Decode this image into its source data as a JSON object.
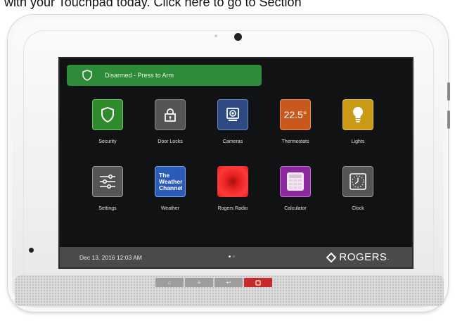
{
  "caption": "with your Touchpad today. Click here to go to Section",
  "screen": {
    "arm_button": {
      "label": "Disarmed - Press to Arm",
      "icon": "shield-icon",
      "color": "#2e8b3a"
    },
    "tiles": [
      {
        "id": "security",
        "label": "Security",
        "icon": "shield-icon",
        "color": "#2f8a2b"
      },
      {
        "id": "door-locks",
        "label": "Door Locks",
        "icon": "lock-icon",
        "color": "#555555"
      },
      {
        "id": "cameras",
        "label": "Cameras",
        "icon": "camera-icon",
        "color": "#2d4a82"
      },
      {
        "id": "thermostats",
        "label": "Thermostats",
        "icon": "thermostat-icon",
        "value": "22.5°",
        "color": "#c9581d"
      },
      {
        "id": "lights",
        "label": "Lights",
        "icon": "lightbulb-icon",
        "color": "#c99a14"
      },
      {
        "id": "settings",
        "label": "Settings",
        "icon": "sliders-icon",
        "color": "#555555"
      },
      {
        "id": "weather",
        "label": "Weather",
        "icon": "weather-channel-logo",
        "logo_lines": [
          "The",
          "Weather",
          "Channel"
        ],
        "color": "#2b5bb8"
      },
      {
        "id": "rogers-radio",
        "label": "Rogers Radio",
        "icon": "radio-icon",
        "color": "#e52020"
      },
      {
        "id": "calculator",
        "label": "Calculator",
        "icon": "calculator-icon",
        "color": "#8b2a9e"
      },
      {
        "id": "clock",
        "label": "Clock",
        "icon": "clock-icon",
        "color": "#555555"
      }
    ],
    "status_bar": {
      "datetime": "Dec 13, 2016 12:03 AM",
      "brand": "ROGERS",
      "brand_suffix": "."
    }
  },
  "hardware_buttons": [
    {
      "id": "home",
      "icon": "home-icon",
      "glyph": "⌂"
    },
    {
      "id": "menu",
      "icon": "menu-icon",
      "glyph": "≡"
    },
    {
      "id": "back",
      "icon": "back-icon",
      "glyph": "↩"
    },
    {
      "id": "panic",
      "icon": "panic-icon",
      "glyph": "",
      "color": "#c62a2a"
    }
  ]
}
